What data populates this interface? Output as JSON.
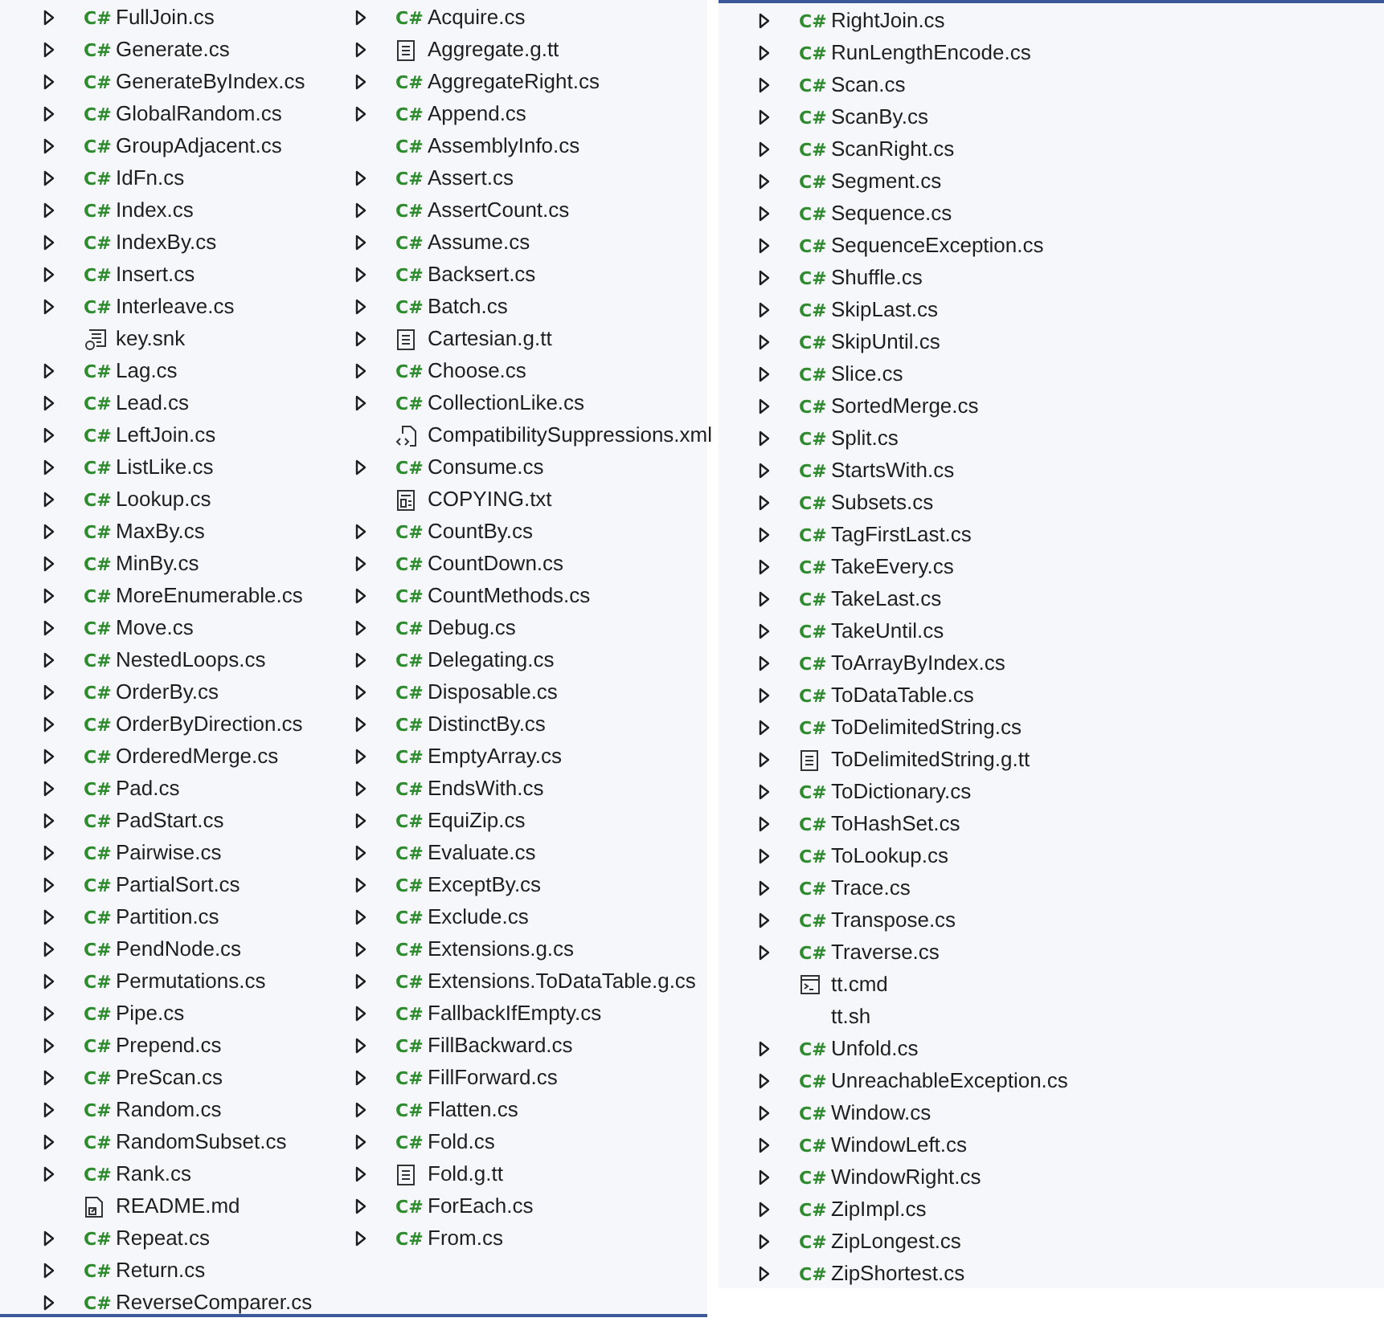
{
  "panels": [
    {
      "columns": [
        {
          "items": [
            {
              "name": "FullJoin.cs",
              "kind": "cs",
              "badge": "C#",
              "expandable": true
            },
            {
              "name": "Generate.cs",
              "kind": "cs",
              "badge": "C#",
              "expandable": true
            },
            {
              "name": "GenerateByIndex.cs",
              "kind": "cs",
              "badge": "C#",
              "expandable": true
            },
            {
              "name": "GlobalRandom.cs",
              "kind": "cs",
              "badge": "C#",
              "expandable": true
            },
            {
              "name": "GroupAdjacent.cs",
              "kind": "cs",
              "badge": "C#",
              "expandable": true
            },
            {
              "name": "IdFn.cs",
              "kind": "cs",
              "badge": "C#",
              "expandable": true
            },
            {
              "name": "Index.cs",
              "kind": "cs",
              "badge": "C#",
              "expandable": true
            },
            {
              "name": "IndexBy.cs",
              "kind": "cs",
              "badge": "C#",
              "expandable": true
            },
            {
              "name": "Insert.cs",
              "kind": "cs",
              "badge": "C#",
              "expandable": true
            },
            {
              "name": "Interleave.cs",
              "kind": "cs",
              "badge": "C#",
              "expandable": true
            },
            {
              "name": "key.snk",
              "kind": "snk",
              "expandable": false
            },
            {
              "name": "Lag.cs",
              "kind": "cs",
              "badge": "C#",
              "expandable": true
            },
            {
              "name": "Lead.cs",
              "kind": "cs",
              "badge": "C#",
              "expandable": true
            },
            {
              "name": "LeftJoin.cs",
              "kind": "cs",
              "badge": "C#",
              "expandable": true
            },
            {
              "name": "ListLike.cs",
              "kind": "cs",
              "badge": "C#",
              "expandable": true
            },
            {
              "name": "Lookup.cs",
              "kind": "cs",
              "badge": "C#",
              "expandable": true
            },
            {
              "name": "MaxBy.cs",
              "kind": "cs",
              "badge": "C#",
              "expandable": true
            },
            {
              "name": "MinBy.cs",
              "kind": "cs",
              "badge": "C#",
              "expandable": true
            },
            {
              "name": "MoreEnumerable.cs",
              "kind": "cs",
              "badge": "C#",
              "expandable": true
            },
            {
              "name": "Move.cs",
              "kind": "cs",
              "badge": "C#",
              "expandable": true
            },
            {
              "name": "NestedLoops.cs",
              "kind": "cs",
              "badge": "C#",
              "expandable": true
            },
            {
              "name": "OrderBy.cs",
              "kind": "cs",
              "badge": "C#",
              "expandable": true
            },
            {
              "name": "OrderByDirection.cs",
              "kind": "cs",
              "badge": "C#",
              "expandable": true
            },
            {
              "name": "OrderedMerge.cs",
              "kind": "cs",
              "badge": "C#",
              "expandable": true
            },
            {
              "name": "Pad.cs",
              "kind": "cs",
              "badge": "C#",
              "expandable": true
            },
            {
              "name": "PadStart.cs",
              "kind": "cs",
              "badge": "C#",
              "expandable": true
            },
            {
              "name": "Pairwise.cs",
              "kind": "cs",
              "badge": "C#",
              "expandable": true
            },
            {
              "name": "PartialSort.cs",
              "kind": "cs",
              "badge": "C#",
              "expandable": true
            },
            {
              "name": "Partition.cs",
              "kind": "cs",
              "badge": "C#",
              "expandable": true
            },
            {
              "name": "PendNode.cs",
              "kind": "cs",
              "badge": "C#",
              "expandable": true
            },
            {
              "name": "Permutations.cs",
              "kind": "cs",
              "badge": "C#",
              "expandable": true
            },
            {
              "name": "Pipe.cs",
              "kind": "cs",
              "badge": "C#",
              "expandable": true
            },
            {
              "name": "Prepend.cs",
              "kind": "cs",
              "badge": "C#",
              "expandable": true
            },
            {
              "name": "PreScan.cs",
              "kind": "cs",
              "badge": "C#",
              "expandable": true
            },
            {
              "name": "Random.cs",
              "kind": "cs",
              "badge": "C#",
              "expandable": true
            },
            {
              "name": "RandomSubset.cs",
              "kind": "cs",
              "badge": "C#",
              "expandable": true
            },
            {
              "name": "Rank.cs",
              "kind": "cs",
              "badge": "C#",
              "expandable": true
            },
            {
              "name": "README.md",
              "kind": "md",
              "expandable": false
            },
            {
              "name": "Repeat.cs",
              "kind": "cs",
              "badge": "C#",
              "expandable": true
            },
            {
              "name": "Return.cs",
              "kind": "cs",
              "badge": "C#",
              "expandable": true
            },
            {
              "name": "ReverseComparer.cs",
              "kind": "cs",
              "badge": "C#",
              "expandable": true
            }
          ]
        },
        {
          "items": [
            {
              "name": "Acquire.cs",
              "kind": "cs",
              "badge": "C#",
              "expandable": true
            },
            {
              "name": "Aggregate.g.tt",
              "kind": "tt",
              "expandable": true
            },
            {
              "name": "AggregateRight.cs",
              "kind": "cs",
              "badge": "C#",
              "expandable": true
            },
            {
              "name": "Append.cs",
              "kind": "cs",
              "badge": "C#",
              "expandable": true
            },
            {
              "name": "AssemblyInfo.cs",
              "kind": "cs",
              "badge": "C#",
              "expandable": false
            },
            {
              "name": "Assert.cs",
              "kind": "cs",
              "badge": "C#",
              "expandable": true
            },
            {
              "name": "AssertCount.cs",
              "kind": "cs",
              "badge": "C#",
              "expandable": true
            },
            {
              "name": "Assume.cs",
              "kind": "cs",
              "badge": "C#",
              "expandable": true
            },
            {
              "name": "Backsert.cs",
              "kind": "cs",
              "badge": "C#",
              "expandable": true
            },
            {
              "name": "Batch.cs",
              "kind": "cs",
              "badge": "C#",
              "expandable": true
            },
            {
              "name": "Cartesian.g.tt",
              "kind": "tt",
              "expandable": true
            },
            {
              "name": "Choose.cs",
              "kind": "cs",
              "badge": "C#",
              "expandable": true
            },
            {
              "name": "CollectionLike.cs",
              "kind": "cs",
              "badge": "C#",
              "expandable": true
            },
            {
              "name": "CompatibilitySuppressions.xml",
              "kind": "xml",
              "expandable": false
            },
            {
              "name": "Consume.cs",
              "kind": "cs",
              "badge": "C#",
              "expandable": true
            },
            {
              "name": "COPYING.txt",
              "kind": "txt",
              "expandable": false
            },
            {
              "name": "CountBy.cs",
              "kind": "cs",
              "badge": "C#",
              "expandable": true
            },
            {
              "name": "CountDown.cs",
              "kind": "cs",
              "badge": "C#",
              "expandable": true
            },
            {
              "name": "CountMethods.cs",
              "kind": "cs",
              "badge": "C#",
              "expandable": true
            },
            {
              "name": "Debug.cs",
              "kind": "cs",
              "badge": "C#",
              "expandable": true
            },
            {
              "name": "Delegating.cs",
              "kind": "cs",
              "badge": "C#",
              "expandable": true
            },
            {
              "name": "Disposable.cs",
              "kind": "cs",
              "badge": "C#",
              "expandable": true
            },
            {
              "name": "DistinctBy.cs",
              "kind": "cs",
              "badge": "C#",
              "expandable": true
            },
            {
              "name": "EmptyArray.cs",
              "kind": "cs",
              "badge": "C#",
              "expandable": true
            },
            {
              "name": "EndsWith.cs",
              "kind": "cs",
              "badge": "C#",
              "expandable": true
            },
            {
              "name": "EquiZip.cs",
              "kind": "cs",
              "badge": "C#",
              "expandable": true
            },
            {
              "name": "Evaluate.cs",
              "kind": "cs",
              "badge": "C#",
              "expandable": true
            },
            {
              "name": "ExceptBy.cs",
              "kind": "cs",
              "badge": "C#",
              "expandable": true
            },
            {
              "name": "Exclude.cs",
              "kind": "cs",
              "badge": "C#",
              "expandable": true
            },
            {
              "name": "Extensions.g.cs",
              "kind": "cs",
              "badge": "C#",
              "expandable": true
            },
            {
              "name": "Extensions.ToDataTable.g.cs",
              "kind": "cs",
              "badge": "C#",
              "expandable": true
            },
            {
              "name": "FallbackIfEmpty.cs",
              "kind": "cs",
              "badge": "C#",
              "expandable": true
            },
            {
              "name": "FillBackward.cs",
              "kind": "cs",
              "badge": "C#",
              "expandable": true
            },
            {
              "name": "FillForward.cs",
              "kind": "cs",
              "badge": "C#",
              "expandable": true
            },
            {
              "name": "Flatten.cs",
              "kind": "cs",
              "badge": "C#",
              "expandable": true
            },
            {
              "name": "Fold.cs",
              "kind": "cs",
              "badge": "C#",
              "expandable": true
            },
            {
              "name": "Fold.g.tt",
              "kind": "tt",
              "expandable": true
            },
            {
              "name": "ForEach.cs",
              "kind": "cs",
              "badge": "C#",
              "expandable": true
            },
            {
              "name": "From.cs",
              "kind": "cs",
              "badge": "C#",
              "expandable": true
            }
          ]
        }
      ]
    },
    {
      "columns": [
        {
          "items": [
            {
              "name": "RightJoin.cs",
              "kind": "cs",
              "badge": "C#",
              "expandable": true
            },
            {
              "name": "RunLengthEncode.cs",
              "kind": "cs",
              "badge": "C#",
              "expandable": true
            },
            {
              "name": "Scan.cs",
              "kind": "cs",
              "badge": "C#",
              "expandable": true
            },
            {
              "name": "ScanBy.cs",
              "kind": "cs",
              "badge": "C#",
              "expandable": true
            },
            {
              "name": "ScanRight.cs",
              "kind": "cs",
              "badge": "C#",
              "expandable": true
            },
            {
              "name": "Segment.cs",
              "kind": "cs",
              "badge": "C#",
              "expandable": true
            },
            {
              "name": "Sequence.cs",
              "kind": "cs",
              "badge": "C#",
              "expandable": true
            },
            {
              "name": "SequenceException.cs",
              "kind": "cs",
              "badge": "C#",
              "expandable": true
            },
            {
              "name": "Shuffle.cs",
              "kind": "cs",
              "badge": "C#",
              "expandable": true
            },
            {
              "name": "SkipLast.cs",
              "kind": "cs",
              "badge": "C#",
              "expandable": true
            },
            {
              "name": "SkipUntil.cs",
              "kind": "cs",
              "badge": "C#",
              "expandable": true
            },
            {
              "name": "Slice.cs",
              "kind": "cs",
              "badge": "C#",
              "expandable": true
            },
            {
              "name": "SortedMerge.cs",
              "kind": "cs",
              "badge": "C#",
              "expandable": true
            },
            {
              "name": "Split.cs",
              "kind": "cs",
              "badge": "C#",
              "expandable": true
            },
            {
              "name": "StartsWith.cs",
              "kind": "cs",
              "badge": "C#",
              "expandable": true
            },
            {
              "name": "Subsets.cs",
              "kind": "cs",
              "badge": "C#",
              "expandable": true
            },
            {
              "name": "TagFirstLast.cs",
              "kind": "cs",
              "badge": "C#",
              "expandable": true
            },
            {
              "name": "TakeEvery.cs",
              "kind": "cs",
              "badge": "C#",
              "expandable": true
            },
            {
              "name": "TakeLast.cs",
              "kind": "cs",
              "badge": "C#",
              "expandable": true
            },
            {
              "name": "TakeUntil.cs",
              "kind": "cs",
              "badge": "C#",
              "expandable": true
            },
            {
              "name": "ToArrayByIndex.cs",
              "kind": "cs",
              "badge": "C#",
              "expandable": true
            },
            {
              "name": "ToDataTable.cs",
              "kind": "cs",
              "badge": "C#",
              "expandable": true
            },
            {
              "name": "ToDelimitedString.cs",
              "kind": "cs",
              "badge": "C#",
              "expandable": true
            },
            {
              "name": "ToDelimitedString.g.tt",
              "kind": "tt",
              "expandable": true
            },
            {
              "name": "ToDictionary.cs",
              "kind": "cs",
              "badge": "C#",
              "expandable": true
            },
            {
              "name": "ToHashSet.cs",
              "kind": "cs",
              "badge": "C#",
              "expandable": true
            },
            {
              "name": "ToLookup.cs",
              "kind": "cs",
              "badge": "C#",
              "expandable": true
            },
            {
              "name": "Trace.cs",
              "kind": "cs",
              "badge": "C#",
              "expandable": true
            },
            {
              "name": "Transpose.cs",
              "kind": "cs",
              "badge": "C#",
              "expandable": true
            },
            {
              "name": "Traverse.cs",
              "kind": "cs",
              "badge": "C#",
              "expandable": true
            },
            {
              "name": "tt.cmd",
              "kind": "cmd",
              "expandable": false
            },
            {
              "name": "tt.sh",
              "kind": "none",
              "expandable": false
            },
            {
              "name": "Unfold.cs",
              "kind": "cs",
              "badge": "C#",
              "expandable": true
            },
            {
              "name": "UnreachableException.cs",
              "kind": "cs",
              "badge": "C#",
              "expandable": true
            },
            {
              "name": "Window.cs",
              "kind": "cs",
              "badge": "C#",
              "expandable": true
            },
            {
              "name": "WindowLeft.cs",
              "kind": "cs",
              "badge": "C#",
              "expandable": true
            },
            {
              "name": "WindowRight.cs",
              "kind": "cs",
              "badge": "C#",
              "expandable": true
            },
            {
              "name": "ZipImpl.cs",
              "kind": "cs",
              "badge": "C#",
              "expandable": true
            },
            {
              "name": "ZipLongest.cs",
              "kind": "cs",
              "badge": "C#",
              "expandable": true
            },
            {
              "name": "ZipShortest.cs",
              "kind": "cs",
              "badge": "C#",
              "expandable": true
            }
          ]
        }
      ]
    }
  ]
}
